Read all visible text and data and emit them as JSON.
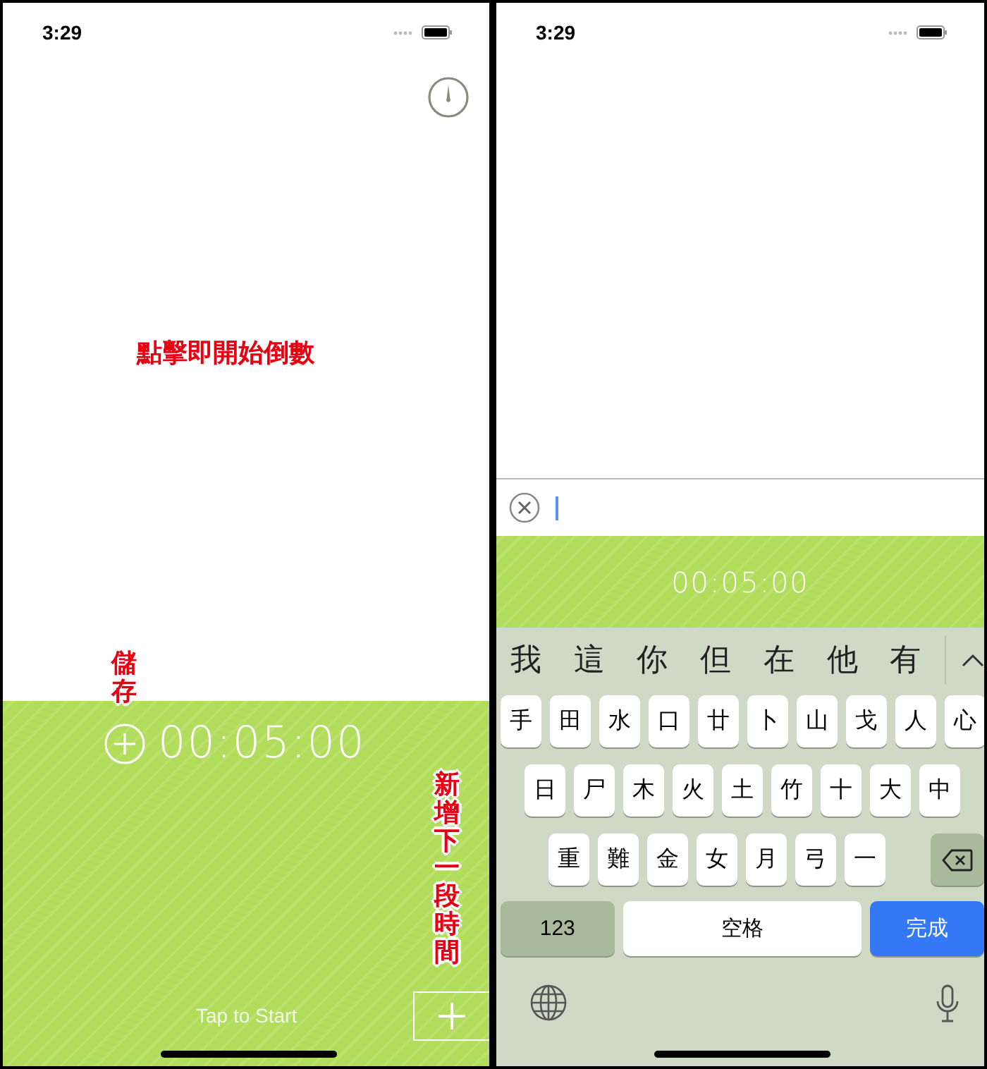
{
  "left_screen": {
    "status_time": "3:29",
    "hint_note": "點擊即開始倒數",
    "save_note": "儲存",
    "timer": "00:05:00",
    "add_note": "新增下一段時間",
    "start_label": "Tap to Start"
  },
  "right_screen": {
    "status_time": "3:29",
    "timer": "00:05:00",
    "keyboard": {
      "candidates": [
        "我",
        "這",
        "你",
        "但",
        "在",
        "他",
        "有"
      ],
      "key_rows": [
        [
          "手",
          "田",
          "水",
          "口",
          "廿",
          "卜",
          "山",
          "戈",
          "人",
          "心"
        ],
        [
          "日",
          "尸",
          "木",
          "火",
          "土",
          "竹",
          "十",
          "大",
          "中"
        ],
        [
          "重",
          "難",
          "金",
          "女",
          "月",
          "弓",
          "一"
        ]
      ],
      "bottom_keys": [
        {
          "label": "123",
          "kind": "mode"
        },
        {
          "label": "空格",
          "kind": "space"
        },
        {
          "label": "完成",
          "kind": "done"
        }
      ]
    }
  }
}
